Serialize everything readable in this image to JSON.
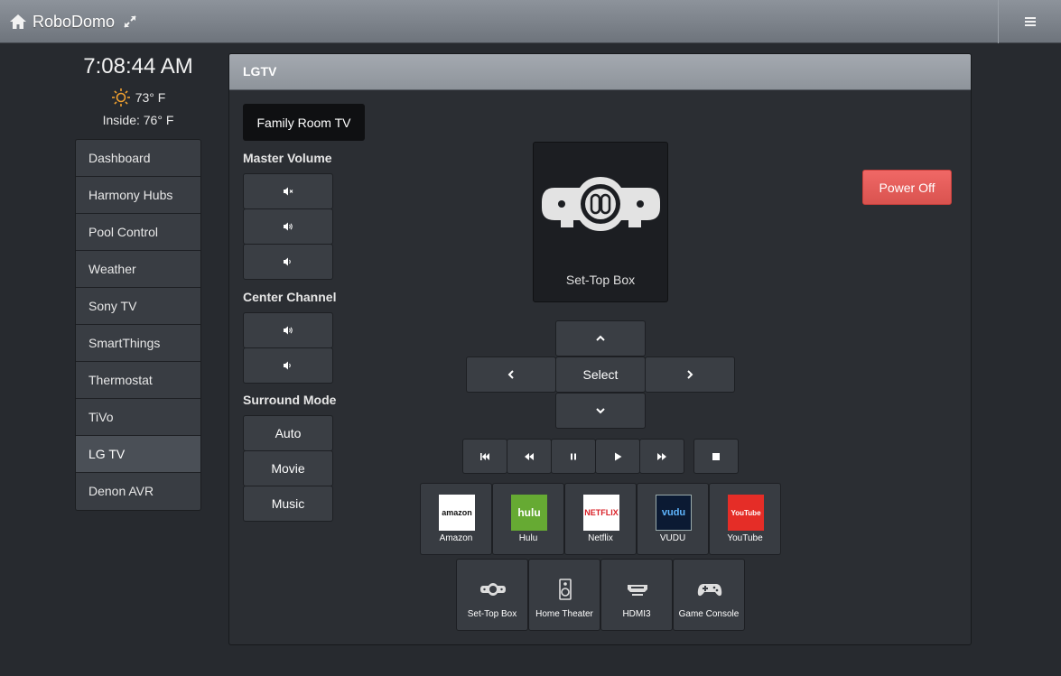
{
  "topbar": {
    "title": "RoboDomo"
  },
  "header": {
    "time": "7:08:44 AM",
    "temperature": "73° F",
    "inside": "Inside: 76° F"
  },
  "sidebar": {
    "items": [
      {
        "label": "Dashboard"
      },
      {
        "label": "Harmony Hubs"
      },
      {
        "label": "Pool Control"
      },
      {
        "label": "Weather"
      },
      {
        "label": "Sony TV"
      },
      {
        "label": "SmartThings"
      },
      {
        "label": "Thermostat"
      },
      {
        "label": "TiVo"
      },
      {
        "label": "LG TV",
        "active": true
      },
      {
        "label": "Denon AVR"
      }
    ]
  },
  "panel": {
    "title": "LGTV",
    "device": "Family Room TV",
    "master_volume_label": "Master Volume",
    "center_channel_label": "Center Channel",
    "surround_label": "Surround Mode",
    "surround_modes": [
      "Auto",
      "Movie",
      "Music"
    ],
    "input_tile_label": "Set-Top Box",
    "power_label": "Power Off",
    "select_label": "Select",
    "apps": [
      {
        "name": "Amazon",
        "logo": "amazon",
        "bg": "#ffffff"
      },
      {
        "name": "Hulu",
        "logo": "hulu",
        "bg": "#66aa33"
      },
      {
        "name": "Netflix",
        "logo": "NETFLIX",
        "bg": "#ffffff"
      },
      {
        "name": "VUDU",
        "logo": "vudu",
        "bg": "#0b1a33"
      },
      {
        "name": "YouTube",
        "logo": "YouTube",
        "bg": "#e52d27"
      }
    ],
    "activities": [
      {
        "name": "Set-Top Box",
        "icon": "set-top-box-icon"
      },
      {
        "name": "Home Theater",
        "icon": "speaker-icon"
      },
      {
        "name": "HDMI3",
        "icon": "hdmi-icon"
      },
      {
        "name": "Game Console",
        "icon": "gamepad-icon"
      }
    ]
  },
  "colors": {
    "power": "#d9534f",
    "accent_sun": "#f0a030"
  }
}
